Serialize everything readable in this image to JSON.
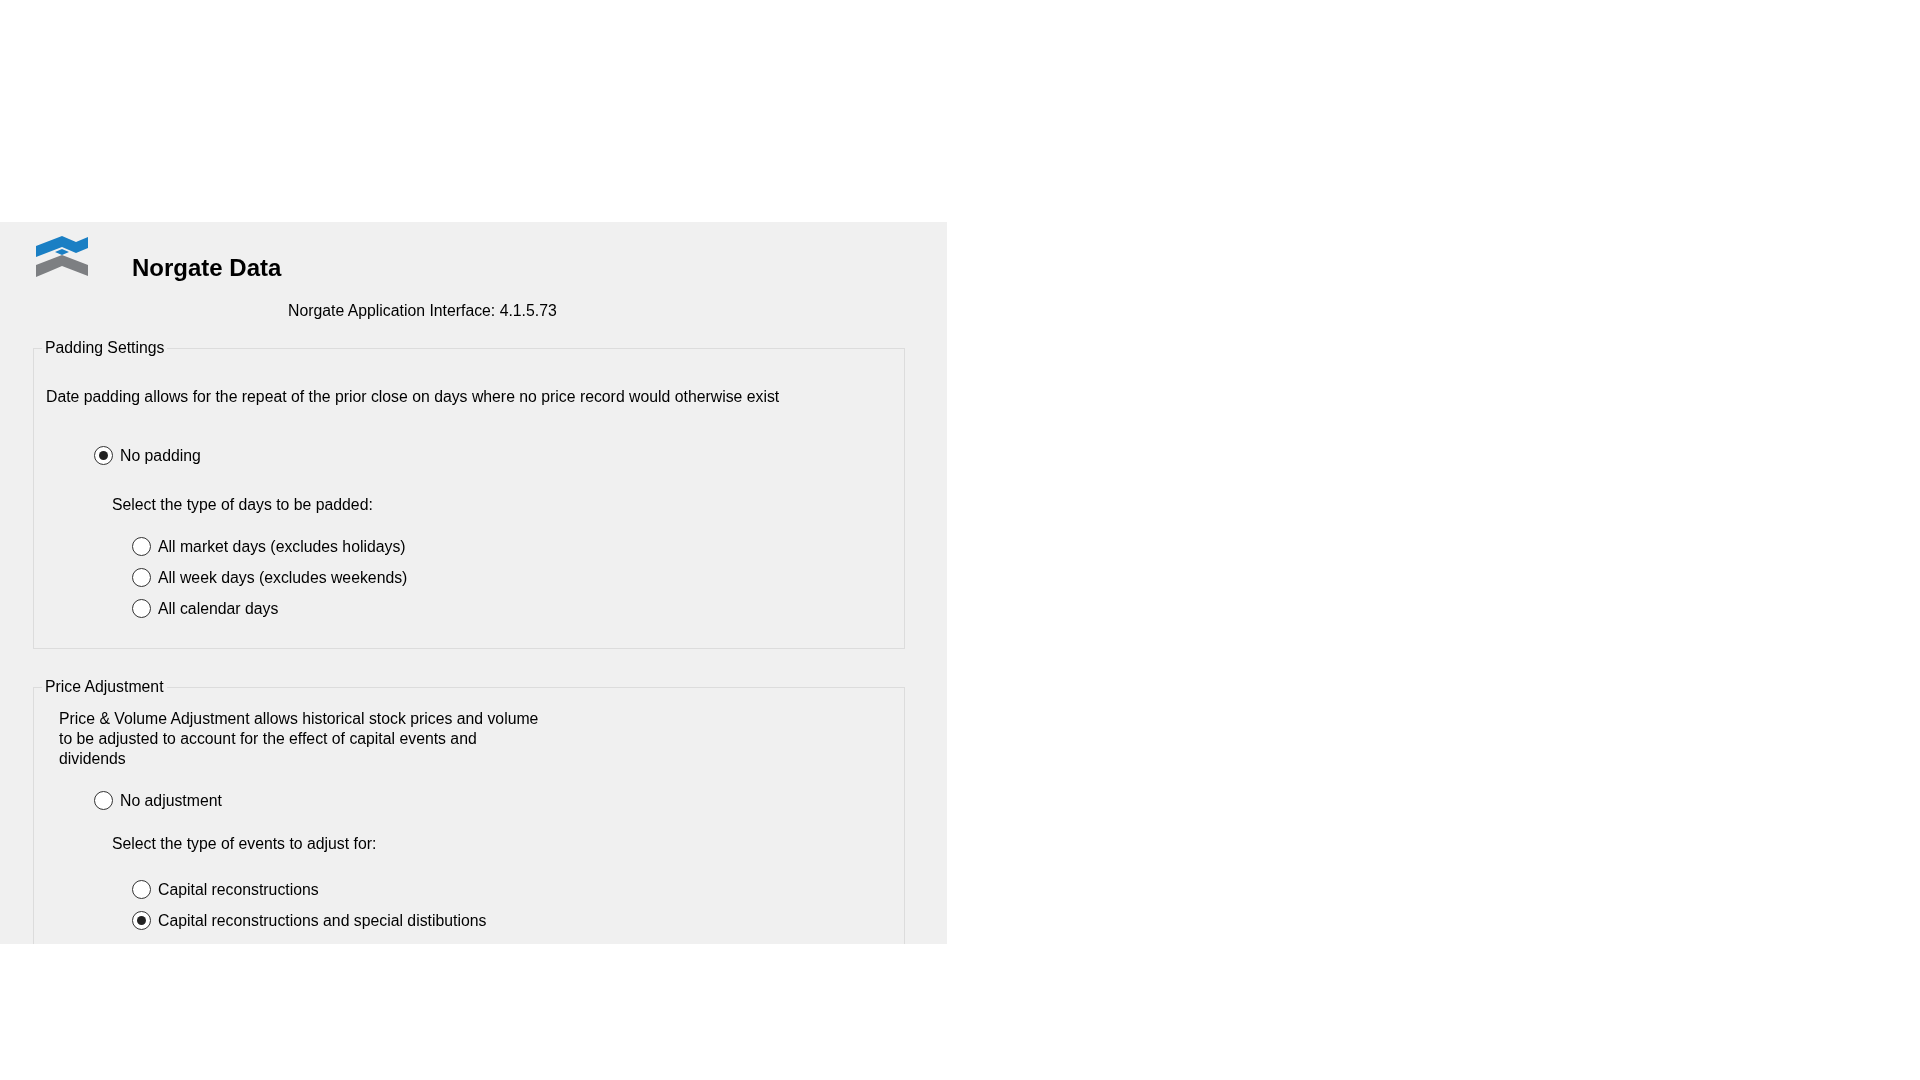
{
  "header": {
    "title": "Norgate Data",
    "version": "Norgate Application Interface: 4.1.5.73"
  },
  "groups": [
    {
      "title": "Padding Settings",
      "description": "Date padding allows for the repeat of the prior close on days where no price record would otherwise exist",
      "main_option": {
        "label": "No padding",
        "selected": true
      },
      "options_label": "Select the type of days to be padded:",
      "options": [
        {
          "label": "All market days (excludes holidays)",
          "selected": false
        },
        {
          "label": "All week days (excludes weekends)",
          "selected": false
        },
        {
          "label": "All calendar days",
          "selected": false
        }
      ]
    },
    {
      "title": "Price Adjustment",
      "description": "Price & Volume Adjustment allows historical stock prices and volume to be adjusted to account for the effect of capital events and dividends",
      "main_option": {
        "label": "No adjustment",
        "selected": false
      },
      "options_label": "Select the type of events to adjust for:",
      "options": [
        {
          "label": "Capital reconstructions",
          "selected": false
        },
        {
          "label": "Capital reconstructions and special distibutions",
          "selected": true
        }
      ]
    }
  ]
}
